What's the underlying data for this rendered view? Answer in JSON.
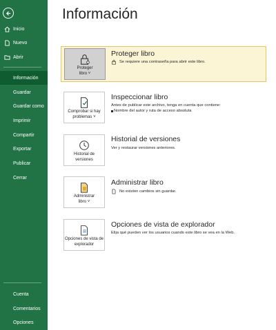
{
  "sidebar": {
    "back_icon": "back-arrow-icon",
    "items": [
      {
        "label": "Inicio",
        "icon": "home-icon"
      },
      {
        "label": "Nuevo",
        "icon": "new-document-icon"
      },
      {
        "label": "Abrir",
        "icon": "open-folder-icon"
      },
      {
        "label": "Información"
      },
      {
        "label": "Guardar"
      },
      {
        "label": "Guardar como"
      },
      {
        "label": "Imprimir"
      },
      {
        "label": "Compartir"
      },
      {
        "label": "Exportar"
      },
      {
        "label": "Publicar"
      },
      {
        "label": "Cerrar"
      },
      {
        "label": "Cuenta"
      },
      {
        "label": "Comentarios"
      },
      {
        "label": "Opciones"
      }
    ],
    "active": "Información",
    "bg_color": "#217346",
    "active_color": "#0e5c2f"
  },
  "main": {
    "title": "Información",
    "sections": {
      "protect": {
        "button_label_1": "Proteger",
        "button_label_2": "libro",
        "title": "Proteger libro",
        "text": "Se requiere una contraseña para abrir este libro.",
        "highlight_color": "#fcf5d5"
      },
      "inspect": {
        "button_label_1": "Comprobar si hay",
        "button_label_2": "problemas",
        "title": "Inspeccionar libro",
        "text": "Antes de publicar este archivo, tenga en cuenta que contiene:",
        "bullet": "Nombre del autor y ruta de acceso absoluta"
      },
      "versions": {
        "button_label_1": "Historial de",
        "button_label_2": "versiones",
        "title": "Historial de versiones",
        "text": "Ver y restaurar versiones anteriores."
      },
      "manage": {
        "button_label_1": "Administrar",
        "button_label_2": "libro",
        "title": "Administrar libro",
        "text": "No existen cambios sin guardar."
      },
      "browser": {
        "button_label_1": "Opciones de vista de",
        "button_label_2": "explorador",
        "title": "Opciones de vista de explorador",
        "text": "Elija qué pueden ver los usuarios cuando este libro se vea en la Web."
      }
    }
  }
}
